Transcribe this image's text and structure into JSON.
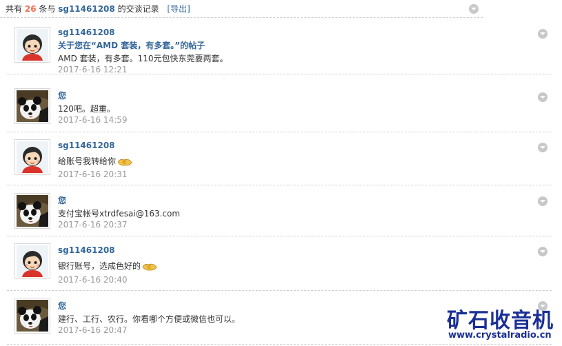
{
  "header": {
    "prefix": "共有",
    "count": "26",
    "mid": "条与",
    "username": "sg11461208",
    "suffix": "的交谈记录",
    "export_label": "[导出]"
  },
  "messages": [
    {
      "sender": "sg11461208",
      "avatar": "girl-avatar",
      "subject": "关于您在“AMD 套装，有多套。”的帖子",
      "body": "AMD 套装，有多套。110元包快东莞要两套。",
      "time": "2017-6-16 12:21"
    },
    {
      "sender": "您",
      "avatar": "panda-avatar",
      "body": "120吧。超重。",
      "time": "2017-6-16 14:59"
    },
    {
      "sender": "sg11461208",
      "avatar": "girl-avatar",
      "body": "给账号我转给你",
      "emoticon": "handshake-icon",
      "time": "2017-6-16 20:31"
    },
    {
      "sender": "您",
      "avatar": "panda-avatar",
      "body": "支付宝帐号xtrdfesai@163.com",
      "time": "2017-6-16 20:37"
    },
    {
      "sender": "sg11461208",
      "avatar": "girl-avatar",
      "body": "银行账号，选成色好的",
      "emoticon": "handshake-icon",
      "time": "2017-6-16 20:40"
    },
    {
      "sender": "您",
      "avatar": "panda-avatar",
      "body": "建行、工行、农行。你看哪个方便或微信也可以。",
      "time": "2017-6-16 20:47"
    }
  ],
  "watermark": {
    "title": "矿石收音机",
    "url": "www.crystalradio.cn"
  },
  "colors": {
    "link": "#336699",
    "count": "#f26c4f",
    "time": "#999999",
    "watermark": "#1a2f96"
  }
}
